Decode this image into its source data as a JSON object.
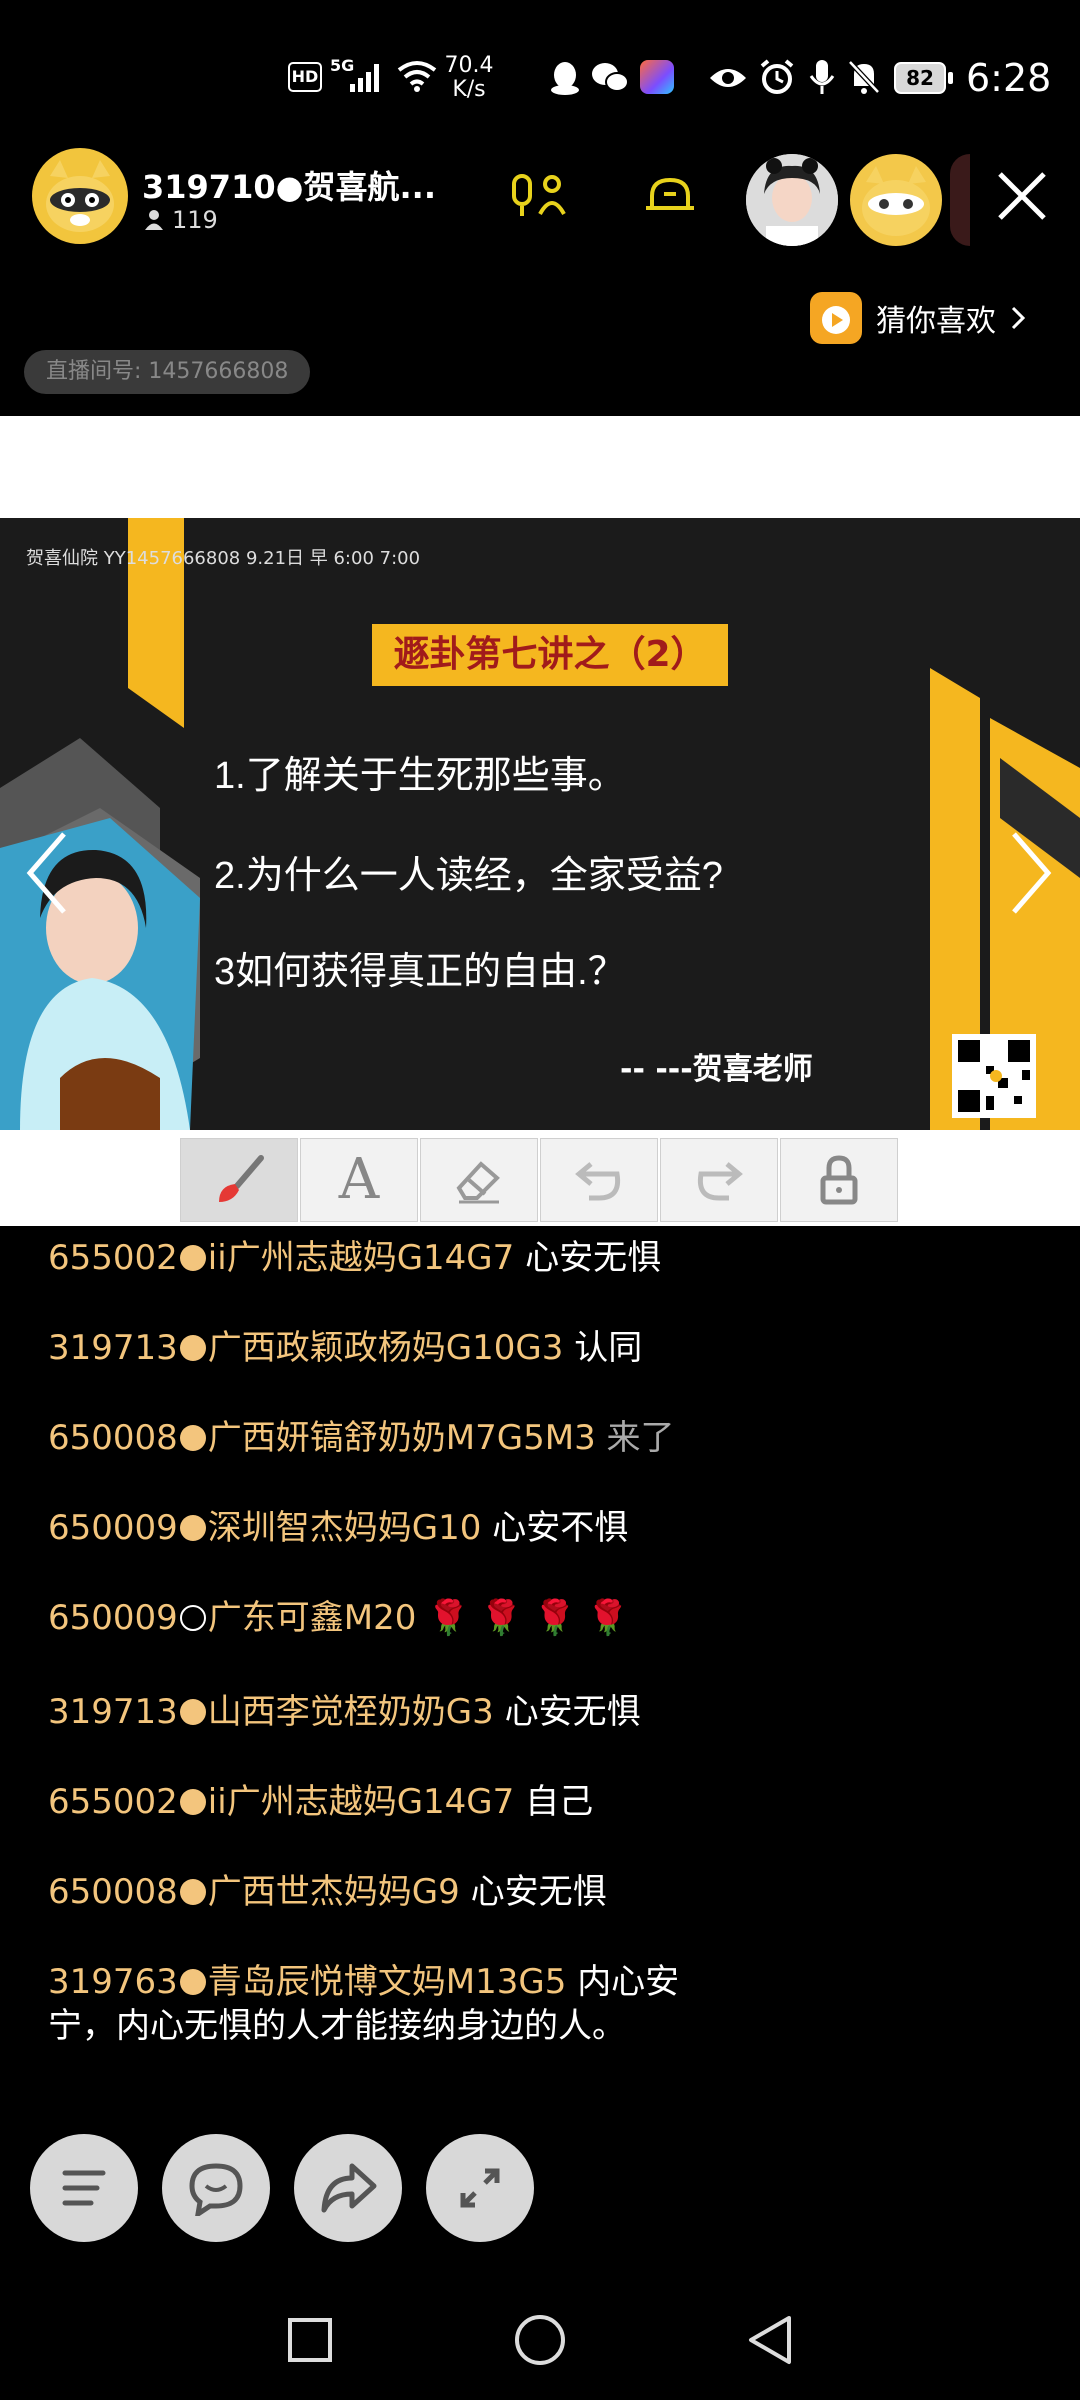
{
  "status_bar": {
    "hd_badge": "HD",
    "network": "5G",
    "speed_value": "70.4",
    "speed_unit": "K/s",
    "battery": "82",
    "time": "6:28"
  },
  "room": {
    "title": "319710●贺喜航...",
    "viewer_count": "119",
    "room_id_label": "直播间号: 1457666808",
    "guess_like": "猜你喜欢"
  },
  "slide": {
    "meta": "贺喜仙院 YY1457666808 9.21日 早 6:00 7:00",
    "banner": "遯卦第七讲之（2）",
    "bullets": [
      "1.了解关于生死那些事。",
      "2.为什么一人读经，全家受益?",
      "3如何获得真正的自由.？"
    ],
    "signature": "-- ---贺喜老师"
  },
  "toolbar": {
    "letter_tool": "A"
  },
  "chat": [
    {
      "user": "655002",
      "dot": "filled",
      "name": "ii广州志越妈G14G7",
      "text": "心安无惧",
      "dim": false
    },
    {
      "user": "319713",
      "dot": "filled",
      "name": "广西政颖政杨妈G10G3",
      "text": "认同",
      "dim": false
    },
    {
      "user": "650008",
      "dot": "filled",
      "name": "广西妍镐舒奶奶M7G5M3",
      "text": "来了",
      "dim": true
    },
    {
      "user": "650009",
      "dot": "filled",
      "name": "深圳智杰妈妈G10",
      "text": "心安不惧",
      "dim": false
    },
    {
      "user": "650009",
      "dot": "hollow",
      "name": "广东可鑫M20",
      "text": "🌹 🌹 🌹 🌹",
      "dim": false
    },
    {
      "user": "319713",
      "dot": "filled",
      "name": "山西李觉桎奶奶G3",
      "text": "心安无惧",
      "dim": false
    },
    {
      "user": "655002",
      "dot": "filled",
      "name": "ii广州志越妈G14G7",
      "text": "自己",
      "dim": false
    },
    {
      "user": "650008",
      "dot": "filled",
      "name": "广西世杰妈妈G9",
      "text": "心安无惧",
      "dim": false
    },
    {
      "user": "319763",
      "dot": "filled",
      "name": "青岛辰悦博文妈M13G5",
      "text": "内心安宁，内心无惧的人才能接纳身边的人。",
      "dim": false
    }
  ],
  "colors": {
    "accent_yellow": "#f5b71f",
    "chat_name": "#f3c57d",
    "mic_icon": "#e8d21c",
    "guess_like_orange": "#f5a623"
  }
}
